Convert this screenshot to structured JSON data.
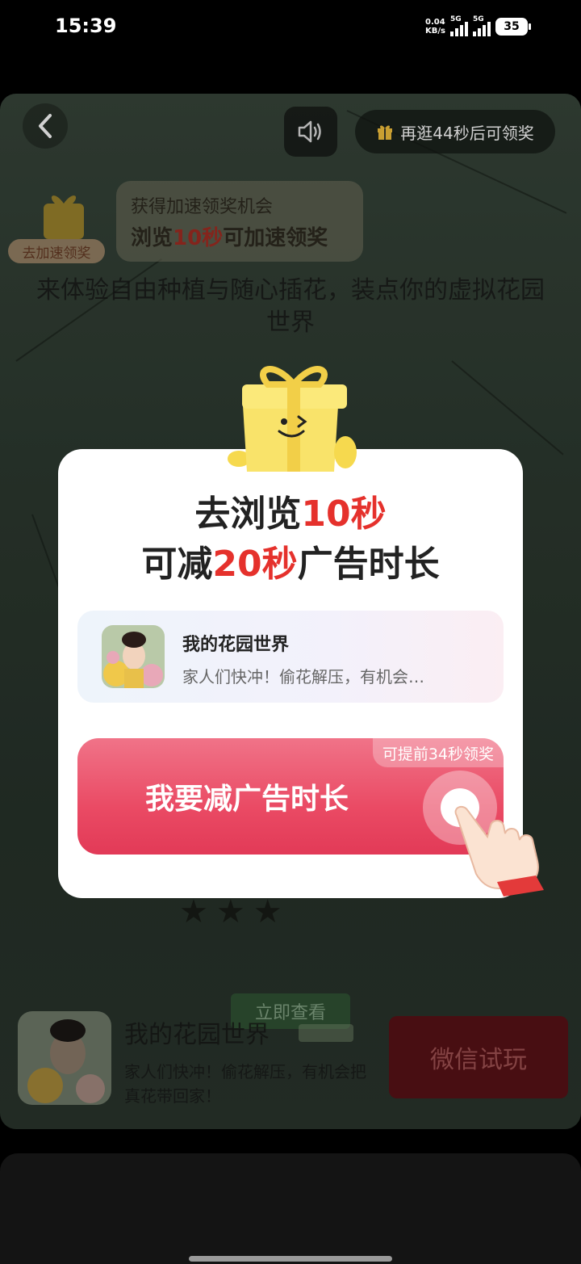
{
  "status_bar": {
    "time": "15:39",
    "net_speed_value": "0.04",
    "net_speed_unit": "KB/s",
    "signal1_label": "5G",
    "signal2_label": "5G",
    "battery": "35"
  },
  "ad": {
    "timer_text": "再逛44秒后可领奖",
    "boost": {
      "tag": "去加速领奖",
      "line1": "获得加速领奖机会",
      "line2_prefix": "浏览",
      "line2_highlight": "10秒",
      "line2_suffix": "可加速领奖"
    },
    "headline": "来体验自由种植与随心插花，装点你的虚拟花园世界",
    "check_button": "立即查看",
    "app_title": "我的花园世界",
    "app_desc": "家人们快冲！偷花解压，有机会把真花带回家！",
    "wechat_button": "微信试玩",
    "star_count": 3
  },
  "modal": {
    "title_line1_prefix": "去浏览",
    "title_line1_highlight": "10秒",
    "title_line2_prefix": "可减",
    "title_line2_highlight": "20秒",
    "title_line2_suffix": "广告时长",
    "app_name": "我的花园世界",
    "app_desc": "家人们快冲！偷花解压，有机会…",
    "cta_label": "我要减广告时长",
    "cta_badge": "可提前34秒领奖"
  },
  "colors": {
    "accent_red": "#e5312c",
    "cta_pink": "#ea4a64",
    "wechat_btn": "#581216"
  },
  "icons": [
    "back-arrow-icon",
    "speaker-icon",
    "gift-icon",
    "gift-mascot-icon",
    "pointing-hand-icon"
  ]
}
